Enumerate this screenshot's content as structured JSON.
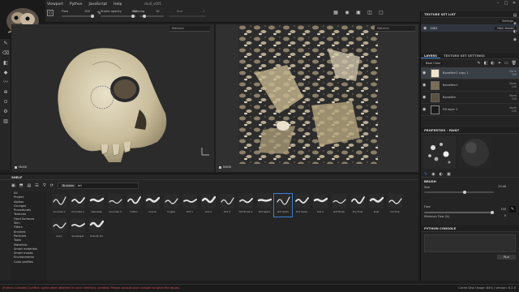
{
  "window": {
    "title": "skull_v001"
  },
  "menu": [
    "Viewport",
    "Python",
    "JavaScript",
    "Help"
  ],
  "tool_options": {
    "flow_label": "Flow",
    "flow_value": "100",
    "stroke_opacity_label": "Stroke opacity",
    "stroke_opacity_value": "100",
    "spacing_label": "Spacing",
    "spacing_value": "10",
    "size_label": "Size",
    "size_value": "1"
  },
  "viewport3d": {
    "channel": "Material",
    "footer": "MASK"
  },
  "viewport2d": {
    "channel": "Material",
    "footer": "MASK"
  },
  "texture_set_list": {
    "header": "TEXTURE SET LIST",
    "settings_label": "Settings",
    "set_name": "1001",
    "shader": "Main shader"
  },
  "layers": {
    "tab_layers": "LAYERS",
    "tab_tss": "TEXTURE SET SETTINGS",
    "channel_select": "Base Color",
    "items": [
      {
        "name": "BoneWrn2 copy 1",
        "blend": "Norm",
        "opacity": "100",
        "selected": true
      },
      {
        "name": "BoneWrn1",
        "blend": "Norm",
        "opacity": "100",
        "selected": false
      },
      {
        "name": "BoneWrn",
        "blend": "Norm",
        "opacity": "100",
        "selected": false
      },
      {
        "name": "Fill layer 1",
        "blend": "Norm",
        "opacity": "100",
        "selected": false
      }
    ]
  },
  "properties": {
    "header": "PROPERTIES - PAINT",
    "brush_section": "BRUSH",
    "size_label": "Size",
    "size_value": "25.46",
    "flow_label": "Flow",
    "flow_value": "100",
    "min_flow_label": "Minimum Flow (%)",
    "min_flow_value": "0"
  },
  "python_console": {
    "header": "PYTHON CONSOLE",
    "run_label": "Run"
  },
  "shelf": {
    "header": "SHELF",
    "filter_tag": "Brushes",
    "search_value": "Art",
    "categories": [
      "All",
      "Project",
      "Alphas",
      "Grunges",
      "Procedurals",
      "Textures",
      "Hard Surfaces",
      "Skin",
      "Filters",
      "Brushes",
      "Particles",
      "Tools",
      "Materials",
      "Smart materials",
      "Smart masks",
      "Environments",
      "Color profiles"
    ],
    "brushes_row1": [
      "Concrete 1",
      "Concrete 2",
      "Dakinsite",
      "Concrete 3",
      "Cotton",
      "Crumb",
      "Crystal",
      "Dirt 1",
      "Dirt 2",
      "Dirt 3",
      "Dirt Brush 2",
      "Dirt Speck",
      "Dirt Spots",
      "Dirt Spots",
      "Dirt 4",
      "Dirt Brush",
      "Dry Fluid",
      "Dust",
      "Ink Drip"
    ],
    "brushes_row2": [
      "Grain",
      "Sandpaper",
      "Smooth Ink"
    ]
  },
  "status": {
    "message": "[Python Console] Conflict: some were detected in your directory, window. Please consult your console to solve the issues.",
    "right": "Cache Disk Usage: 84% | Version: 6.2.0"
  },
  "colors": {
    "accent": "#3a80d8",
    "error": "#d65050"
  }
}
